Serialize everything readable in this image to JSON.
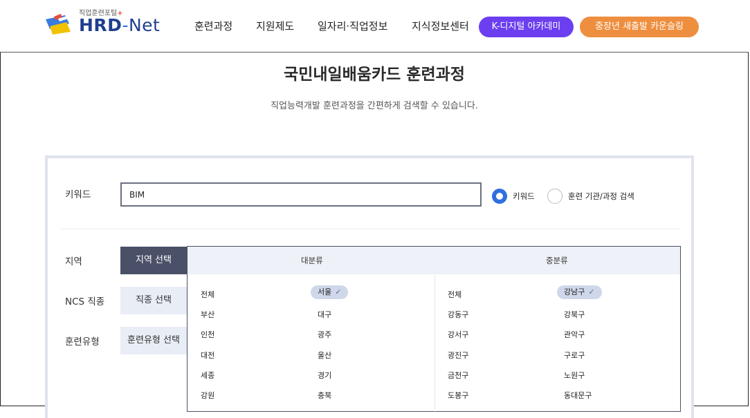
{
  "logo": {
    "subtitle": "직업훈련포털",
    "plus": "+",
    "brand": "HRD",
    "dash": "-",
    "net": "Net"
  },
  "nav": {
    "items": [
      "훈련과정",
      "지원제도",
      "일자리·직업정보",
      "지식정보센터"
    ],
    "k_digital": "K-디지털 아카데미",
    "counseling": "중장년 새출발 카운슬링"
  },
  "colors": {
    "purple": "#6b3ff0",
    "orange": "#ee8f3f",
    "radio_active": "#2f6fe0",
    "tab_active": "#4a5067"
  },
  "page": {
    "title": "국민내일배움카드 훈련과정",
    "subtitle": "직업능력개발 훈련과정을 간편하게 검색할 수 있습니다."
  },
  "search": {
    "keyword_label": "키워드",
    "keyword_value": "BIM",
    "radio_keyword": "키워드",
    "radio_org": "훈련 기관/과정 검색",
    "selected_radio": "키워드"
  },
  "filters": {
    "region_label": "지역",
    "ncs_label": "NCS 직종",
    "type_label": "훈련유형",
    "region_tab": "지역 선택",
    "ncs_tab": "직종 선택",
    "type_tab": "훈련유형 선택"
  },
  "region_box": {
    "major_header": "대분류",
    "minor_header": "중분류",
    "check_icon": "check-icon",
    "major": [
      "전체",
      "서울",
      "부산",
      "대구",
      "인천",
      "광주",
      "대전",
      "울산",
      "세종",
      "경기",
      "강원",
      "충북"
    ],
    "minor": [
      "전체",
      "강남구",
      "강동구",
      "강북구",
      "강서구",
      "관악구",
      "광진구",
      "구로구",
      "금천구",
      "노원구",
      "도봉구",
      "동대문구"
    ],
    "selected_major": "서울",
    "selected_minor": "강남구"
  }
}
